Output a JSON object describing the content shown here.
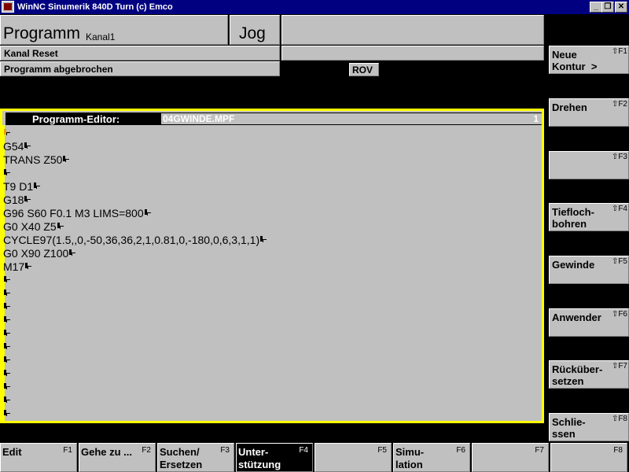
{
  "window": {
    "title": "WinNC Sinumerik 840D Turn (c) Emco",
    "min_glyph": "_",
    "restore_glyph": "❐",
    "close_glyph": "✕"
  },
  "status": {
    "area": "Programm",
    "channel": "Kanal1",
    "mode": "Jog",
    "channel_state": "Kanal Reset",
    "program_state": "Programm abgebrochen",
    "rov": "ROV"
  },
  "editor": {
    "label": "Programm-Editor:",
    "filename": "04GWINDE.MPF",
    "line_number": "1",
    "lines": [
      "",
      "G54",
      "TRANS Z50",
      "",
      "T9 D1",
      "G18",
      "G96 S60 F0.1 M3 LIMS=800",
      "G0 X40 Z5",
      "CYCLE97(1.5,,0,-50,36,36,2,1,0.81,0,-180,0,6,3,1,1)",
      "G0 X90 Z100",
      "M17",
      "",
      "",
      "",
      "",
      "",
      "",
      "",
      "",
      "",
      "",
      ""
    ]
  },
  "vertical_softkeys": [
    {
      "label": "Neue\nKontur  >",
      "key": "⇧F1"
    },
    {
      "label": "Drehen",
      "key": "⇧F2"
    },
    {
      "label": "",
      "key": "⇧F3"
    },
    {
      "label": "Tiefloch-\nbohren",
      "key": "⇧F4"
    },
    {
      "label": "Gewinde",
      "key": "⇧F5"
    },
    {
      "label": "Anwender",
      "key": "⇧F6"
    },
    {
      "label": "Rücküber-\nsetzen",
      "key": "⇧F7"
    },
    {
      "label": "Schlie-\nssen",
      "key": "⇧F8"
    }
  ],
  "horizontal_softkeys": [
    {
      "label": "Edit",
      "key": "F1"
    },
    {
      "label": "Gehe zu ...",
      "key": "F2"
    },
    {
      "label": "Suchen/\nErsetzen",
      "key": "F3"
    },
    {
      "label": "Unter-\nstützung",
      "key": "F4"
    },
    {
      "label": "",
      "key": "F5"
    },
    {
      "label": "Simu-\nlation",
      "key": "F6"
    },
    {
      "label": "",
      "key": "F7"
    },
    {
      "label": "",
      "key": "F8"
    }
  ],
  "colors": {
    "titlebar": "#000080",
    "panel": "#c0c0c0",
    "editor_border": "#ffff00",
    "background": "#000000"
  }
}
